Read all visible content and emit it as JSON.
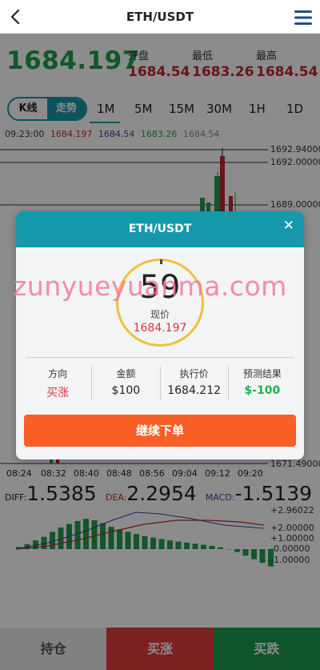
{
  "header": {
    "title": "ETH/USDT",
    "back_icon": "chevron-left-icon",
    "menu_icon": "menu-icon"
  },
  "ticker": {
    "price": "1684.197",
    "stats": [
      {
        "label": "开盘",
        "value": "1684.54"
      },
      {
        "label": "最低",
        "value": "1683.26"
      },
      {
        "label": "最高",
        "value": "1684.54"
      }
    ]
  },
  "tabs": {
    "mode_kline": "K线",
    "mode_trend": "走势",
    "periods": [
      "1M",
      "5M",
      "15M",
      "30M",
      "1H",
      "1D"
    ],
    "active_period": "1M"
  },
  "ohlc": {
    "time": "09:23:00",
    "open": "1684.197",
    "high": "1684.54",
    "low": "1683.26",
    "close": "1684.54"
  },
  "chart_data": {
    "type": "candlestick",
    "price_axis_labels": [
      "1692.94000",
      "1692.00000",
      "1689.00000",
      "1671.49000"
    ],
    "visible_price_labels": [
      "1692.94000",
      "1692.00000",
      "1689.00000",
      "1671.49000"
    ],
    "time_labels": [
      "08:24",
      "08:32",
      "08:40",
      "08:48",
      "08:56",
      "09:04",
      "09:12",
      "09:20"
    ],
    "macd_axis_labels": [
      "+2.96022",
      "+2.00000",
      "+1.00000",
      "-0.00000",
      "-1.00000"
    ],
    "macd_values": [
      0.15,
      0.35,
      0.6,
      0.85,
      1.2,
      1.5,
      1.75,
      1.95,
      2.1,
      2.0,
      1.8,
      1.55,
      1.35,
      1.2,
      1.05,
      0.9,
      0.8,
      0.7,
      0.6,
      0.52,
      0.45,
      0.38,
      0.3,
      0.22,
      0.12,
      0.0,
      -0.2,
      -0.45,
      -0.7,
      -0.95,
      -1.2
    ]
  },
  "indicators": {
    "diff_label": "DIFF:",
    "diff_value": "1.5385",
    "dea_label": "DEA:",
    "dea_value": "2.2954",
    "macd_label": "MACD:",
    "macd_value": "-1.5139"
  },
  "bottom": {
    "hold": "持仓",
    "buy_up": "买涨",
    "buy_down": "买跌"
  },
  "modal": {
    "title": "ETH/USDT",
    "countdown": "59",
    "now_label": "现价",
    "now_price": "1684.197",
    "info": [
      {
        "label": "方向",
        "value": "买涨"
      },
      {
        "label": "金额",
        "value": "$100"
      },
      {
        "label": "执行价",
        "value": "1684.212"
      },
      {
        "label": "预测结果",
        "value": "$-100"
      }
    ],
    "continue_label": "继续下单"
  },
  "watermark": "zunyueyuanma.com",
  "colors": {
    "accent": "#1599aa",
    "up": "#c0272d",
    "down": "#1f9e4b",
    "cta": "#fa5f26"
  }
}
